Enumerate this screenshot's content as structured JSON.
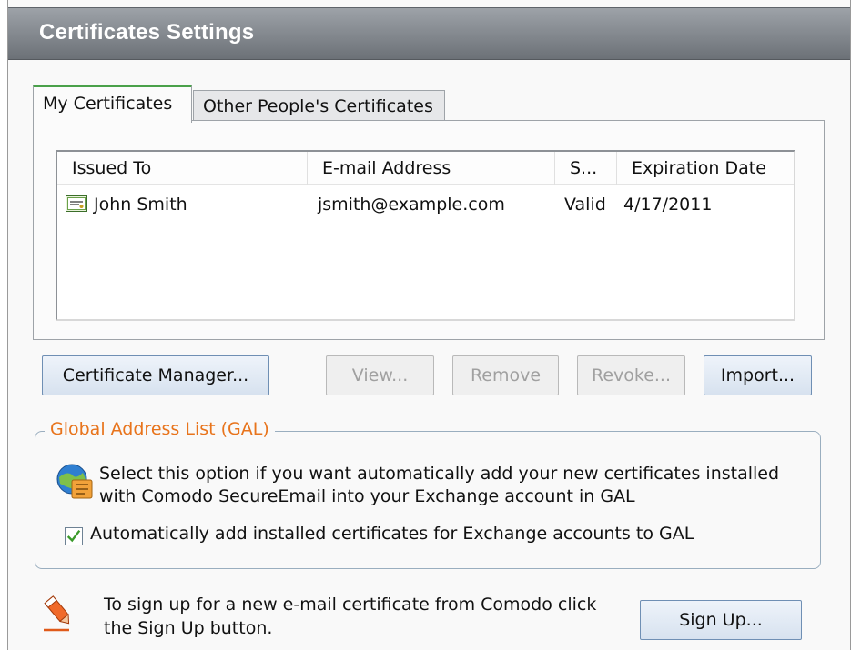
{
  "window": {
    "title": "Certificates Settings"
  },
  "tabs": [
    {
      "label": "My Certificates",
      "active": true
    },
    {
      "label": "Other People's Certificates",
      "active": false
    }
  ],
  "cert_list": {
    "columns": [
      "Issued To",
      "E-mail Address",
      "S...",
      "Expiration Date"
    ],
    "rows": [
      {
        "issued_to": "John Smith",
        "email": "jsmith@example.com",
        "status": "Valid",
        "expiration": "4/17/2011",
        "icon": "certificate-icon"
      }
    ]
  },
  "buttons": {
    "certificate_manager": "Certificate Manager...",
    "view": "View...",
    "remove": "Remove",
    "revoke": "Revoke...",
    "import": "Import...",
    "sign_up": "Sign Up..."
  },
  "gal": {
    "legend": "Global Address List (GAL)",
    "description": "Select this option if you want automatically add your new certificates installed with Comodo SecureEmail into your Exchange account in GAL",
    "checkbox_label": "Automatically add installed certificates for Exchange accounts to GAL",
    "checkbox_checked": true,
    "icon": "globe-address-book-icon"
  },
  "signup": {
    "text": "To sign up for a new e-mail certificate from Comodo click the Sign Up button.",
    "icon": "pen-signup-icon"
  },
  "colors": {
    "title_bar": "#8a8f95",
    "legend_text": "#e8741c",
    "active_tab_accent": "#4aa14a",
    "button_border": "#6f8fb4"
  }
}
